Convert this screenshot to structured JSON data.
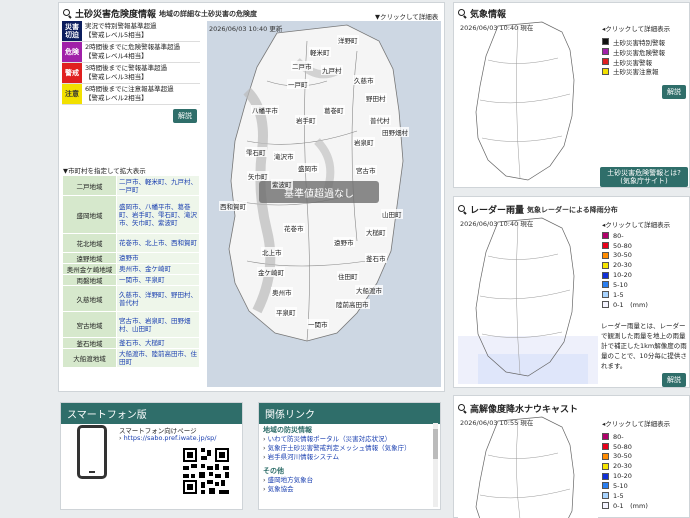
{
  "landslide": {
    "title": "土砂災害危険度情報",
    "subtitle": "地域の詳細な土砂災害の危険度",
    "click_hint": "▼クリックして詳細表示",
    "timestamp": "2026/06/03 10:40 更新",
    "overlay": "基準値超過なし",
    "levels": [
      {
        "tag": "災害切迫",
        "color": "#0c1d5e",
        "line1": "実況で特別警報基準超過",
        "line2": "【警戒レベル5相当】"
      },
      {
        "tag": "危険",
        "color": "#a020a8",
        "line1": "2時間後までに危険警報基準超過",
        "line2": "【警戒レベル4相当】"
      },
      {
        "tag": "警戒",
        "color": "#e02020",
        "line1": "3時間後までに警報基準超過",
        "line2": "【警戒レベル3相当】"
      },
      {
        "tag": "注意",
        "color": "#f2e000",
        "line1": "6時間後までに注意報基準超過",
        "line2": "【警戒レベル2相当】"
      }
    ],
    "explain_button": "解説",
    "muni_header": "▼市町村を指定して拡大表示",
    "municipalities": [
      {
        "region": "二戸地域",
        "cities": "二戸市、軽米町、九戸村、一戸町"
      },
      {
        "region": "盛岡地域",
        "cities": "盛岡市、八幡平市、葛巻町、岩手町、雫石町、滝沢市、矢巾町、紫波町"
      },
      {
        "region": "花北地域",
        "cities": "花巻市、北上市、西和賀町"
      },
      {
        "region": "遠野地域",
        "cities": "遠野市"
      },
      {
        "region": "奥州金ケ崎地域",
        "cities": "奥州市、金ケ崎町"
      },
      {
        "region": "両磐地域",
        "cities": "一関市、平泉町"
      },
      {
        "region": "久慈地域",
        "cities": "久慈市、洋野町、野田村、普代村"
      },
      {
        "region": "宮古地域",
        "cities": "宮古市、岩泉町、田野畑村、山田町"
      },
      {
        "region": "釜石地域",
        "cities": "釜石市、大槌町"
      },
      {
        "region": "大船渡地域",
        "cities": "大船渡市、陸前高田市、住田町"
      }
    ],
    "map_labels": [
      {
        "text": "洋野町"
      },
      {
        "text": "軽米町"
      },
      {
        "text": "二戸市"
      },
      {
        "text": "九戸村"
      },
      {
        "text": "久慈市"
      },
      {
        "text": "野田村"
      },
      {
        "text": "一戸町"
      },
      {
        "text": "葛巻町"
      },
      {
        "text": "普代村"
      },
      {
        "text": "八幡平市"
      },
      {
        "text": "岩手町"
      },
      {
        "text": "田野畑村"
      },
      {
        "text": "岩泉町"
      },
      {
        "text": "雫石町"
      },
      {
        "text": "滝沢市"
      },
      {
        "text": "盛岡市"
      },
      {
        "text": "宮古市"
      },
      {
        "text": "紫波町"
      },
      {
        "text": "矢巾町"
      },
      {
        "text": "山田町"
      },
      {
        "text": "西和賀町"
      },
      {
        "text": "花巻市"
      },
      {
        "text": "遠野市"
      },
      {
        "text": "大槌町"
      },
      {
        "text": "北上市"
      },
      {
        "text": "釜石市"
      },
      {
        "text": "金ケ崎町"
      },
      {
        "text": "住田町"
      },
      {
        "text": "奥州市"
      },
      {
        "text": "大船渡市"
      },
      {
        "text": "平泉町"
      },
      {
        "text": "陸前高田市"
      },
      {
        "text": "一関市"
      }
    ]
  },
  "weather": {
    "title": "気象情報",
    "timestamp": "2026/06/03 10:40 現在",
    "click_hint": "◂クリックして詳細表示",
    "legend": [
      {
        "label": "土砂災害特別警報",
        "color": "#111111"
      },
      {
        "label": "土砂災害危険警報",
        "color": "#a020a8"
      },
      {
        "label": "土砂災害警報",
        "color": "#e02020"
      },
      {
        "label": "土砂災害注意報",
        "color": "#f2e000"
      }
    ],
    "explain_button": "解説",
    "jma_button_line1": "土砂災害危険警報とは?",
    "jma_button_line2": "(気象庁サイト)"
  },
  "radar": {
    "title": "レーダー雨量",
    "subtitle": "気象レーダーによる降雨分布",
    "timestamp": "2026/06/03 10:40 現在",
    "click_hint": "◂クリックして詳細表示",
    "legend": [
      {
        "label": "80-",
        "color": "#b0006a"
      },
      {
        "label": "50-80",
        "color": "#e8001a"
      },
      {
        "label": "30-50",
        "color": "#ff8c00"
      },
      {
        "label": "20-30",
        "color": "#f5e400"
      },
      {
        "label": "10-20",
        "color": "#1030d8"
      },
      {
        "label": "5-10",
        "color": "#2a7ef0"
      },
      {
        "label": "1-5",
        "color": "#a8d4ff"
      },
      {
        "label": "0-1　(mm)",
        "color": "#f4f4ff"
      }
    ],
    "description": "レーダー雨量とは、レーダーで観測した雨量を地上の雨量計で補正した1km解像度の雨量のことで、10分毎に提供されます。",
    "explain_button": "解説"
  },
  "nowcast": {
    "title": "高解像度降水ナウキャスト",
    "timestamp": "2026/06/03 10:55 現在",
    "click_hint": "◂クリックして詳細表示",
    "legend": [
      {
        "label": "80-",
        "color": "#b0006a"
      },
      {
        "label": "50-80",
        "color": "#e8001a"
      },
      {
        "label": "30-50",
        "color": "#ff8c00"
      },
      {
        "label": "20-30",
        "color": "#f5e400"
      },
      {
        "label": "10-20",
        "color": "#1030d8"
      },
      {
        "label": "5-10",
        "color": "#2a7ef0"
      },
      {
        "label": "1-5",
        "color": "#a8d4ff"
      },
      {
        "label": "0-1　(mm)",
        "color": "#f4f4ff"
      }
    ]
  },
  "smartphone": {
    "title": "スマートフォン版",
    "text": "スマートフォン向けページ",
    "url": "https://sabo.pref.iwate.jp/sp/"
  },
  "links": {
    "title": "関係リンク",
    "categories": [
      {
        "name": "地域の防災情報",
        "items": [
          "いわて防災情報ポータル（災害対応状況）",
          "気象庁土砂災害警戒判定メッシュ情報（気象庁）",
          "岩手県河川情報システム"
        ]
      },
      {
        "name": "その他",
        "items": [
          "盛岡地方気象台",
          "気象協会"
        ]
      }
    ]
  }
}
